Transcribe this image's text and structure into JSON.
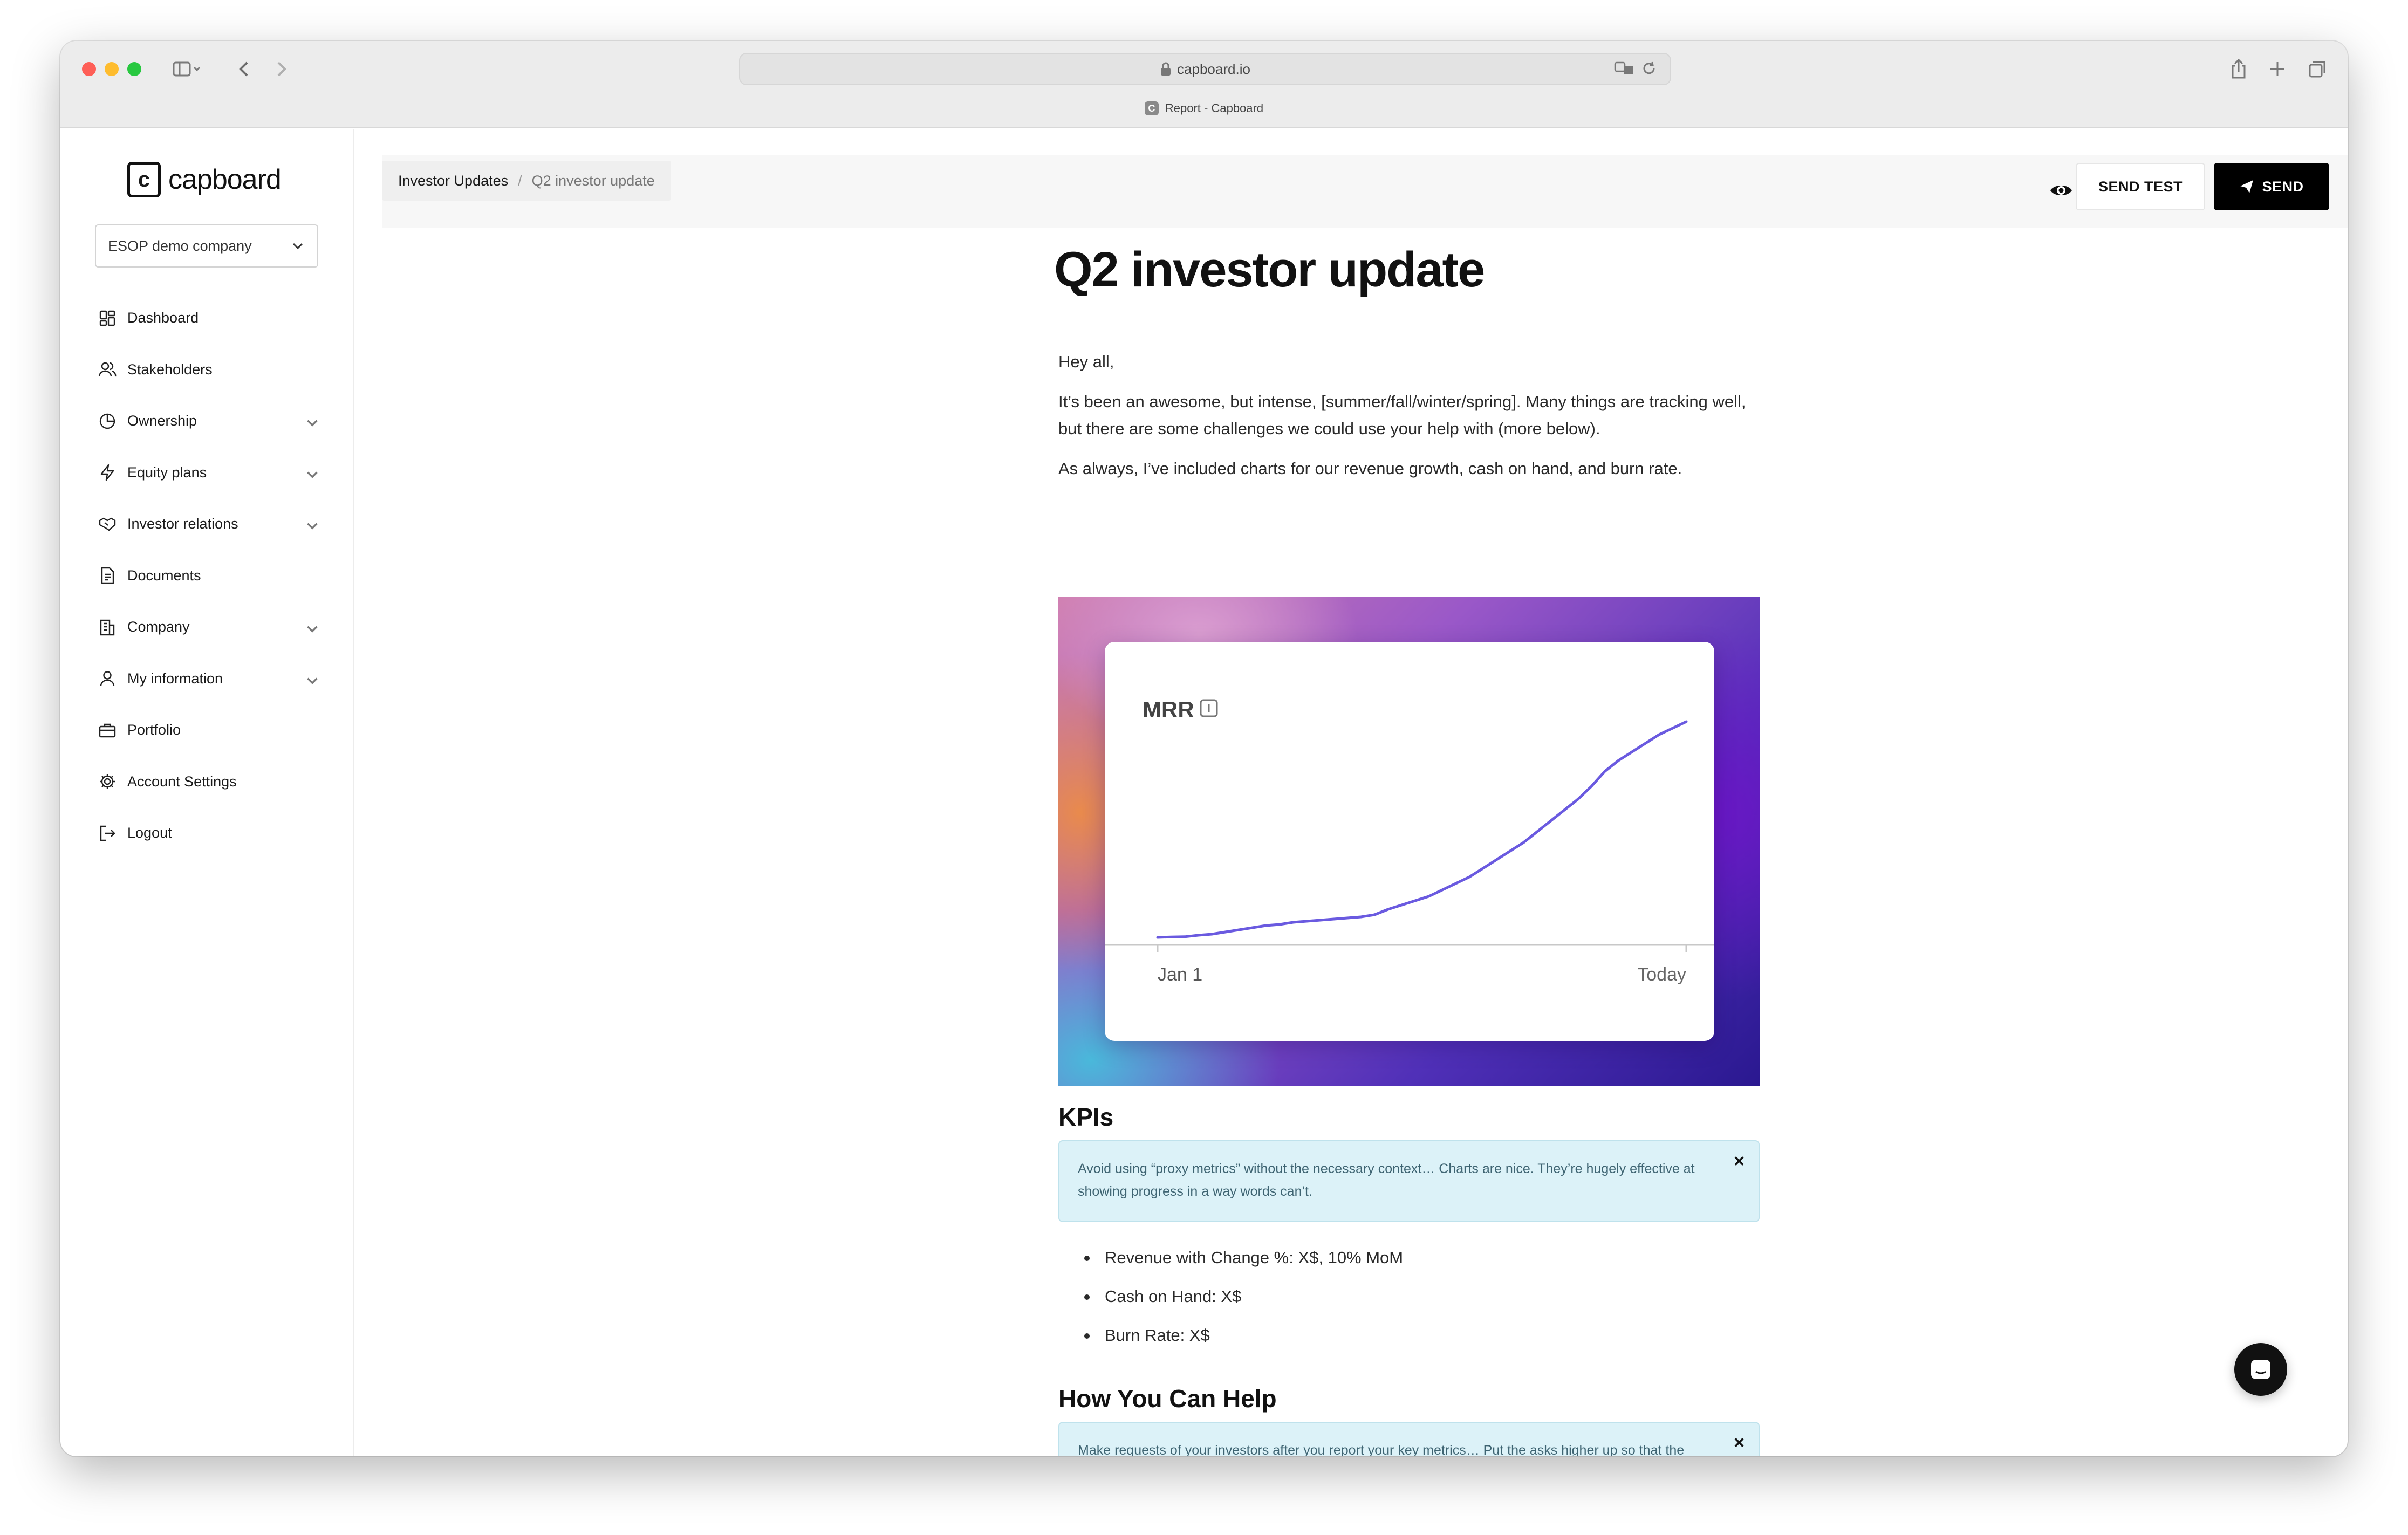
{
  "browser": {
    "url": "capboard.io",
    "tab_title": "Report - Capboard",
    "tab_favicon": "C"
  },
  "sidebar": {
    "logo_mark": "c",
    "logo_text": "capboard",
    "company_select": "ESOP demo company",
    "items": [
      {
        "label": "Dashboard",
        "icon": "dashboard-icon",
        "expandable": false
      },
      {
        "label": "Stakeholders",
        "icon": "users-icon",
        "expandable": false
      },
      {
        "label": "Ownership",
        "icon": "pie-chart-icon",
        "expandable": true
      },
      {
        "label": "Equity plans",
        "icon": "lightning-icon",
        "expandable": true
      },
      {
        "label": "Investor relations",
        "icon": "handshake-icon",
        "expandable": true
      },
      {
        "label": "Documents",
        "icon": "document-icon",
        "expandable": false
      },
      {
        "label": "Company",
        "icon": "building-icon",
        "expandable": true
      },
      {
        "label": "My information",
        "icon": "user-icon",
        "expandable": true
      },
      {
        "label": "Portfolio",
        "icon": "briefcase-icon",
        "expandable": false
      },
      {
        "label": "Account Settings",
        "icon": "gear-icon",
        "expandable": false
      },
      {
        "label": "Logout",
        "icon": "logout-icon",
        "expandable": false
      }
    ]
  },
  "header": {
    "breadcrumb_parent": "Investor Updates",
    "breadcrumb_separator": "/",
    "breadcrumb_current": "Q2 investor update",
    "send_test_label": "SEND TEST",
    "send_label": "SEND"
  },
  "document": {
    "title": "Q2 investor update",
    "greeting": "Hey all,",
    "paragraph_1": "It’s been an awesome, but intense, [summer/fall/winter/spring]. Many things are tracking well, but there are some challenges we could use your help with (more below).",
    "paragraph_2": "As always, I’ve included charts for our revenue growth, cash on hand, and burn rate.",
    "kpi_heading": "KPIs",
    "kpi_tip": "Avoid using “proxy metrics” without the necessary context… Charts are nice. They’re hugely effective at showing progress in a way words can’t.",
    "kpi_bullets": [
      "Revenue with Change %: X$, 10% MoM",
      "Cash on Hand: X$",
      "Burn Rate: X$"
    ],
    "help_heading": "How You Can Help",
    "help_tip": "Make requests of your investors after you report your key metrics… Put the asks higher up so that the investors definitely see them. Key metrics and asks should be front and center to improve your hit rate.",
    "close_glyph": "×"
  },
  "chart_data": {
    "type": "line",
    "title": "MRR",
    "x_start_label": "Jan 1",
    "x_end_label": "Today",
    "series_color": "#6a5ae0",
    "y_axis_visible": false,
    "grid": false,
    "values": [
      0,
      0.2,
      0.3,
      1,
      1.5,
      2.5,
      3.5,
      4.5,
      5.5,
      6,
      7,
      7.5,
      8,
      8.5,
      9,
      9.5,
      10.5,
      13,
      15,
      17,
      19,
      22,
      25,
      28,
      32,
      36,
      40,
      44,
      49,
      54,
      59,
      64,
      70,
      77,
      82,
      86,
      90,
      94,
      97,
      100
    ]
  }
}
